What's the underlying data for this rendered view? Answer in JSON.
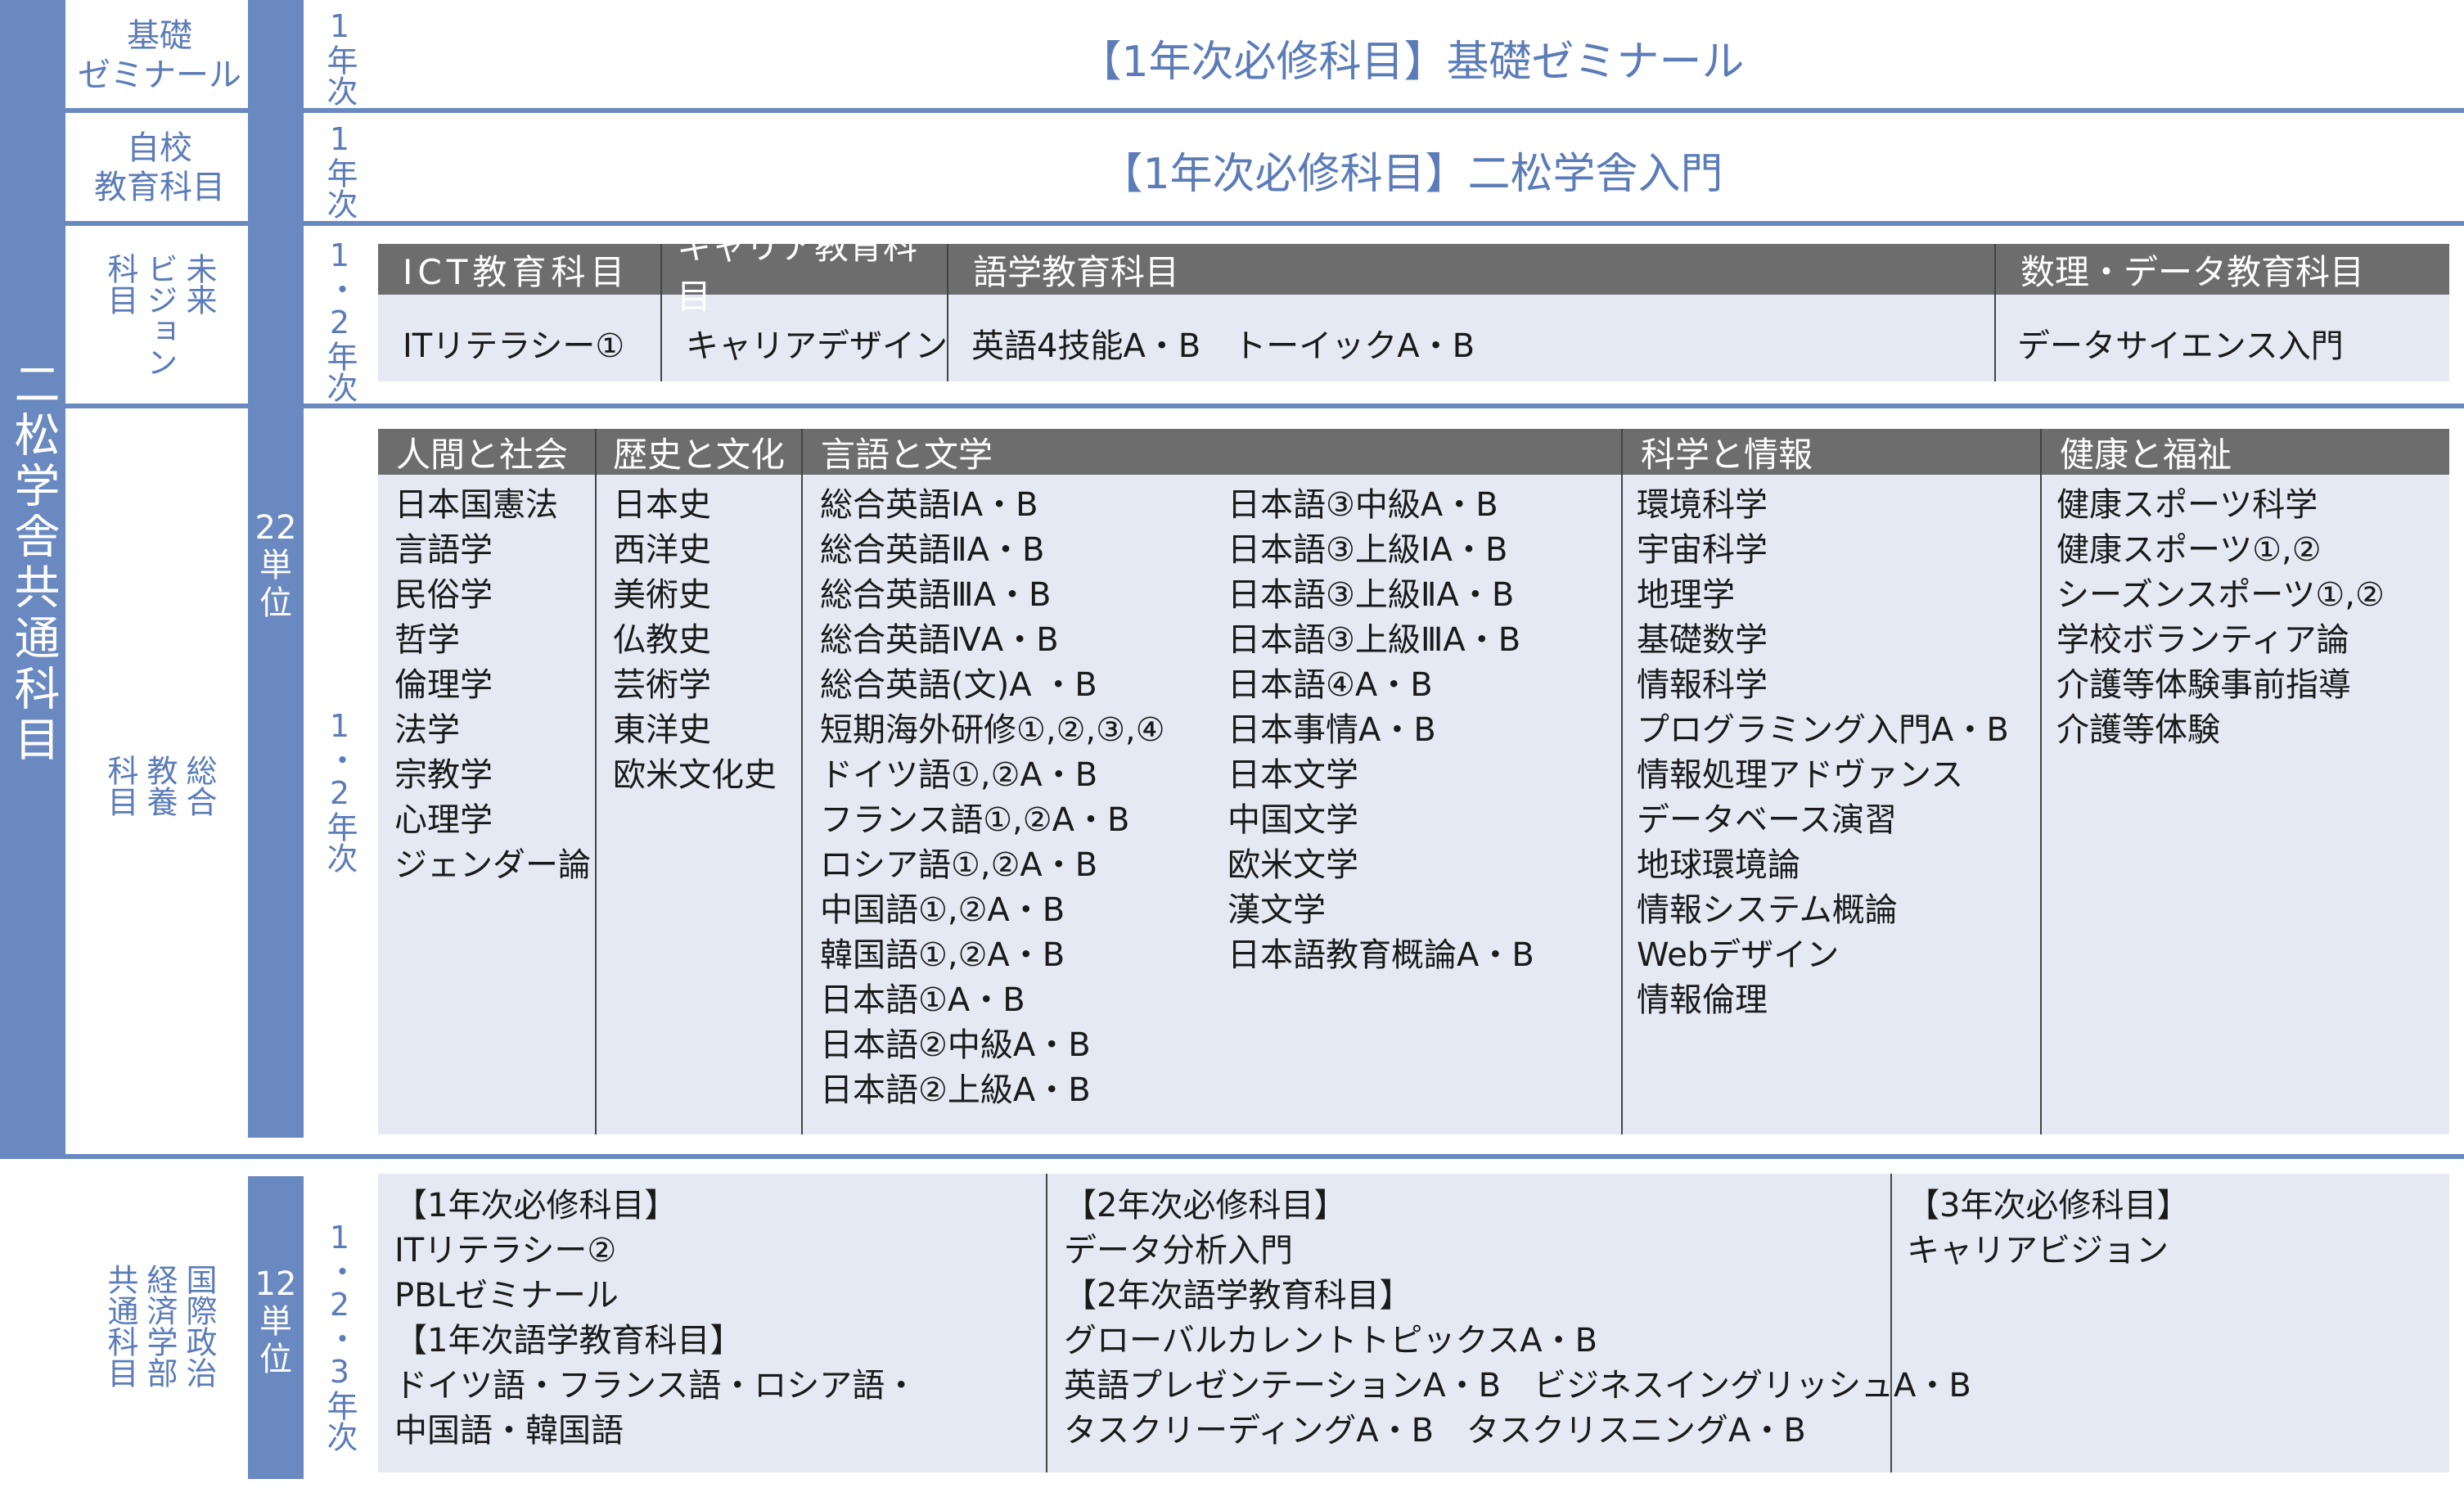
{
  "main_column_label": "二松学舎共通科目",
  "credits_22": "22単位",
  "credits_12": "12単位",
  "rows": {
    "kiso": {
      "label": "基礎\nゼミナール",
      "year": "1年次",
      "title": "【1年次必修科目】基礎ゼミナール"
    },
    "jikou": {
      "label": "自校\n教育科目",
      "year": "1年次",
      "title": "【1年次必修科目】二松学舎入門"
    },
    "mirai": {
      "label": "未来\nビジョン\n科目",
      "year": "1・2年次",
      "headers": [
        "ICT教育科目",
        "キャリア教育科目",
        "語学教育科目",
        "数理・データ教育科目"
      ],
      "cells": [
        "ITリテラシー①",
        "キャリアデザイン",
        "英語4技能A・B　トーイックA・B",
        "データサイエンス入門"
      ]
    },
    "sougou": {
      "label": "総合\n教養\n科目",
      "year": "1・2年次",
      "headers": [
        "人間と社会",
        "歴史と文化",
        "言語と文学",
        "科学と情報",
        "健康と福祉"
      ],
      "columns": {
        "ningen": [
          "日本国憲法",
          "言語学",
          "民俗学",
          "哲学",
          "倫理学",
          "法学",
          "宗教学",
          "心理学",
          "ジェンダー論"
        ],
        "rekishi": [
          "日本史",
          "西洋史",
          "美術史",
          "仏教史",
          "芸術学",
          "東洋史",
          "欧米文化史"
        ],
        "gengo_a": [
          "総合英語ⅠA・B",
          "総合英語ⅡA・B",
          "総合英語ⅢA・B",
          "総合英語ⅣA・B",
          "総合英語(文)A ・B",
          "短期海外研修①,②,③,④",
          "ドイツ語①,②A・B",
          "フランス語①,②A・B",
          "ロシア語①,②A・B",
          "中国語①,②A・B",
          "韓国語①,②A・B",
          "日本語①A・B",
          "日本語②中級A・B",
          "日本語②上級A・B"
        ],
        "gengo_b": [
          "日本語③中級A・B",
          "日本語③上級ⅠA・B",
          "日本語③上級ⅡA・B",
          "日本語③上級ⅢA・B",
          "日本語④A・B",
          "日本事情A・B",
          "日本文学",
          "中国文学",
          "欧米文学",
          "漢文学",
          "日本語教育概論A・B"
        ],
        "kagaku": [
          "環境科学",
          "宇宙科学",
          "地理学",
          "基礎数学",
          "情報科学",
          "プログラミング入門A・B",
          "情報処理アドヴァンス",
          "データベース演習",
          "地球環境論",
          "情報システム概論",
          "Webデザイン",
          "情報倫理"
        ],
        "kenkou": [
          "健康スポーツ科学",
          "健康スポーツ①,②",
          "シーズンスポーツ①,②",
          "学校ボランティア論",
          "介護等体験事前指導",
          "介護等体験"
        ]
      }
    },
    "kokusai": {
      "label": "国際政治\n経済学部\n共通科目",
      "year": "1・2・3年次",
      "col1": [
        "【1年次必修科目】",
        "ITリテラシー②",
        "PBLゼミナール",
        "【1年次語学教育科目】",
        "ドイツ語・フランス語・ロシア語・",
        "中国語・韓国語"
      ],
      "col2": [
        "【2年次必修科目】",
        "データ分析入門",
        "【2年次語学教育科目】",
        "グローバルカレントトピックスA・B",
        "英語プレゼンテーションA・B　ビジネスイングリッシュA・B",
        "タスクリーディングA・B　タスクリスニングA・B"
      ],
      "col3": [
        "【3年次必修科目】",
        "キャリアビジョン"
      ]
    }
  }
}
